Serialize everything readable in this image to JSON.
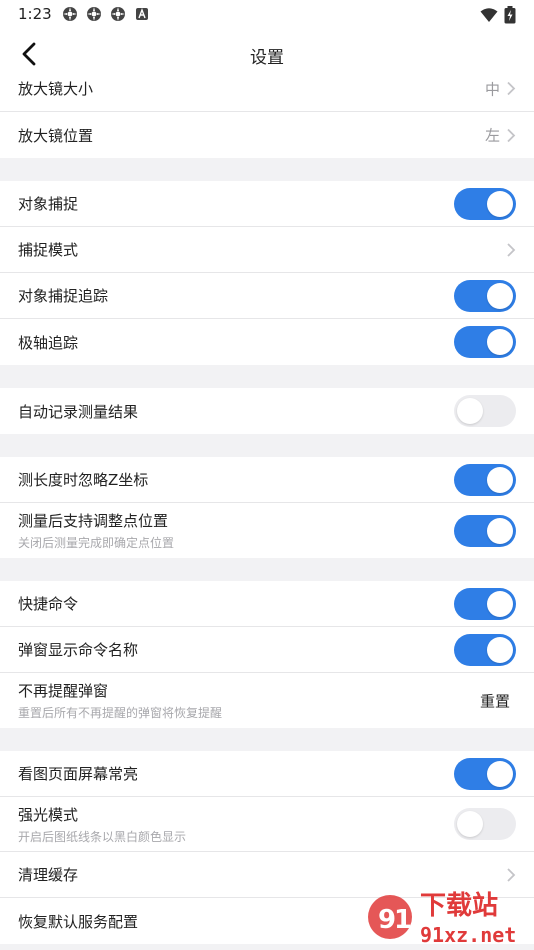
{
  "status": {
    "time": "1:23",
    "icons": [
      "app-notification-icon",
      "app-notification-icon",
      "app-notification-icon",
      "a-badge-icon"
    ],
    "right_icons": [
      "wifi-icon",
      "battery-icon"
    ]
  },
  "header": {
    "title": "设置"
  },
  "groups": [
    {
      "rows": [
        {
          "label": "放大镜大小",
          "value": "中",
          "type": "select"
        },
        {
          "label": "放大镜位置",
          "value": "左",
          "type": "select"
        }
      ]
    },
    {
      "rows": [
        {
          "label": "对象捕捉",
          "type": "toggle",
          "on": true
        },
        {
          "label": "捕捉模式",
          "type": "link"
        },
        {
          "label": "对象捕捉追踪",
          "type": "toggle",
          "on": true
        },
        {
          "label": "极轴追踪",
          "type": "toggle",
          "on": true
        }
      ]
    },
    {
      "rows": [
        {
          "label": "自动记录测量结果",
          "type": "toggle",
          "on": false
        }
      ]
    },
    {
      "rows": [
        {
          "label": "测长度时忽略Z坐标",
          "type": "toggle",
          "on": true
        },
        {
          "label": "测量后支持调整点位置",
          "sub": "关闭后测量完成即确定点位置",
          "type": "toggle",
          "on": true
        }
      ]
    },
    {
      "rows": [
        {
          "label": "快捷命令",
          "type": "toggle",
          "on": true
        },
        {
          "label": "弹窗显示命令名称",
          "type": "toggle",
          "on": true
        },
        {
          "label": "不再提醒弹窗",
          "sub": "重置后所有不再提醒的弹窗将恢复提醒",
          "type": "action",
          "action": "重置"
        }
      ]
    },
    {
      "rows": [
        {
          "label": "看图页面屏幕常亮",
          "type": "toggle",
          "on": true
        },
        {
          "label": "强光模式",
          "sub": "开启后图纸线条以黑白颜色显示",
          "type": "toggle",
          "on": false
        },
        {
          "label": "清理缓存",
          "type": "link"
        },
        {
          "label": "恢复默认服务配置",
          "type": "link"
        }
      ]
    }
  ],
  "watermark": {
    "line1": "下载站",
    "line2": "91xz.net"
  },
  "colors": {
    "accent": "#2f7ee6",
    "toggle_off": "#ececef",
    "background": "#f2f2f4"
  }
}
